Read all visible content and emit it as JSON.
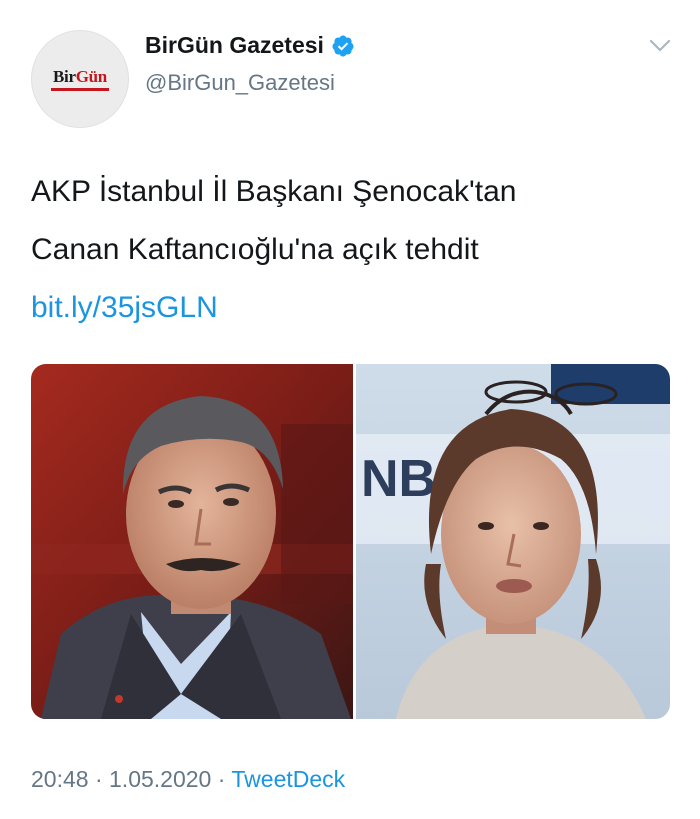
{
  "tweet": {
    "author": {
      "display_name": "BirGün Gazetesi",
      "handle": "@BirGun_Gazetesi",
      "logo_text_dark": "Bir",
      "logo_text_red": "Gün",
      "verified": true,
      "verified_icon": "verified-badge-icon"
    },
    "menu_icon": "chevron-down-icon",
    "text_lines": [
      "AKP İstanbul İl Başkanı Şenocak'tan",
      "Canan Kaftancıoğlu'na açık tehdit"
    ],
    "link": "bit.ly/35jsGLN",
    "media": {
      "left_sign_text": "",
      "right_sign_text": "NB"
    },
    "time": "20:48",
    "date": "1.05.2020",
    "separator": "·",
    "source": "TweetDeck"
  },
  "colors": {
    "link": "#1b95e0",
    "secondary_text": "#657786",
    "primary_text": "#14171a",
    "brand_red": "#c4161c"
  }
}
